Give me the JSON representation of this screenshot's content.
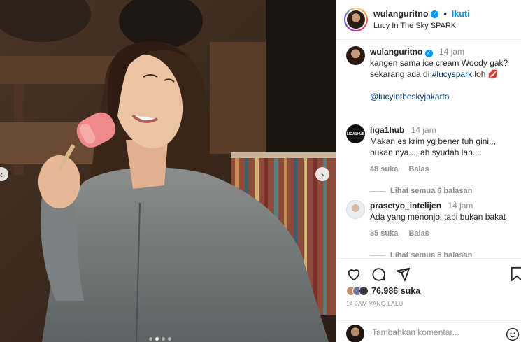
{
  "post": {
    "image_alt": "woman eating pink ice cream",
    "carousel_dots": 4,
    "carousel_active": 1
  },
  "header": {
    "username": "wulanguritno",
    "separator": "•",
    "follow_label": "Ikuti",
    "location": "Lucy In The Sky SPARK"
  },
  "caption": {
    "username": "wulanguritno",
    "time": "14 jam",
    "text_line1": "kangen sama ice cream Woody gak?",
    "text_line2_prefix": "sekarang ada di ",
    "hashtag": "#lucyspark",
    "text_line2_suffix": " loh ",
    "emoji": "💋",
    "mention": "@lucyintheskyjakarta"
  },
  "comments": [
    {
      "username": "liga1hub",
      "avatar_text": "LIGA1HUB",
      "time": "14 jam",
      "text": "Makan es krim yg bener tuh gini.., bukan nya..., ah syudah lah....",
      "likes": "48 suka",
      "reply_label": "Balas",
      "view_replies": "Lihat semua 6 balasan"
    },
    {
      "username": "prasetyo_intelijen",
      "time": "14 jam",
      "text": "Ada yang menonjol tapi bukan bakat",
      "likes": "35 suka",
      "reply_label": "Balas",
      "view_replies": "Lihat semua 5 balasan"
    }
  ],
  "actions": {
    "like_icon": "heart-icon",
    "comment_icon": "comment-icon",
    "share_icon": "share-icon",
    "save_icon": "bookmark-icon"
  },
  "likes": {
    "count": "76.986",
    "label": "suka"
  },
  "time_ago": "14 JAM YANG LALU",
  "add_comment": {
    "placeholder": "Tambahkan komentar..."
  },
  "colors": {
    "accent": "#0095f6",
    "link": "#00376b",
    "muted": "#8e8e8e"
  }
}
